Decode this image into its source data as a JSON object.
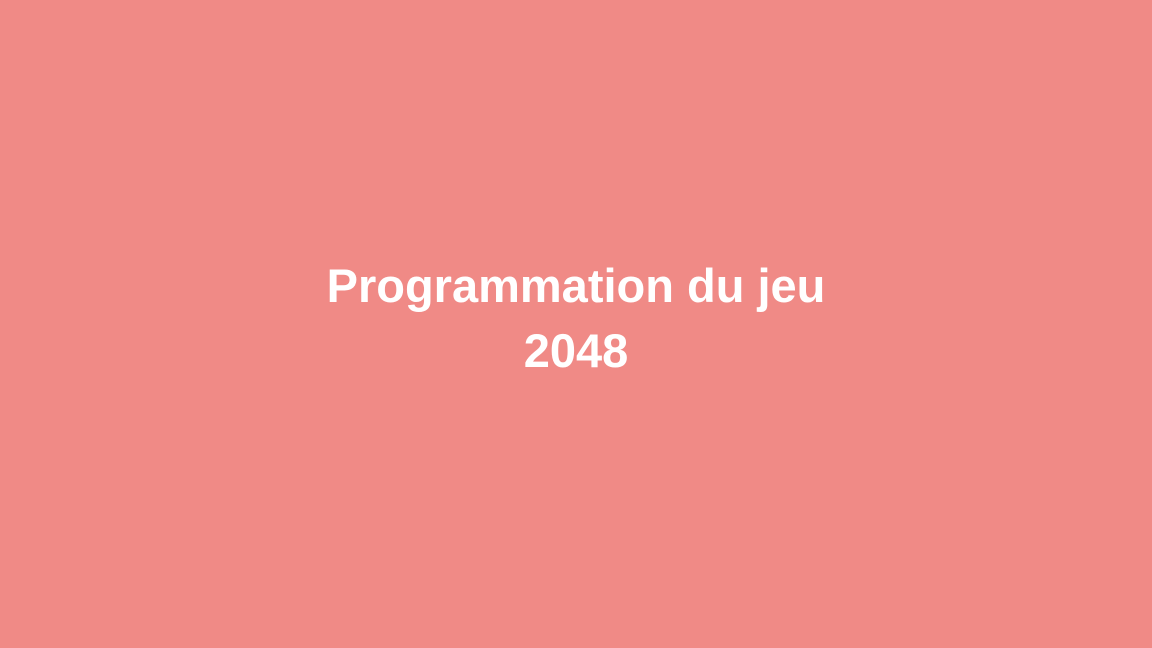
{
  "slide": {
    "background_color": "#f08a86",
    "text_color": "#ffffff",
    "title_line_1": "Programmation du jeu",
    "title_line_2": "2048"
  }
}
